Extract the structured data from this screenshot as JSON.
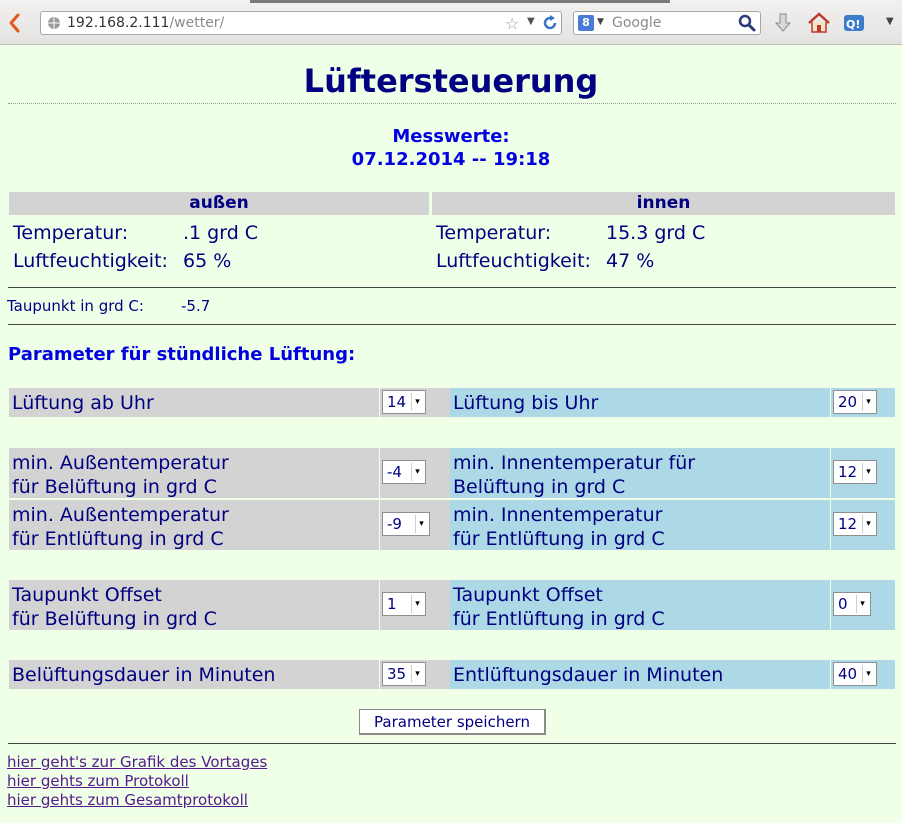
{
  "browser": {
    "url_host": "192.168.2.111",
    "url_path": "/wetter/",
    "search_placeholder": "Google"
  },
  "page": {
    "title": "Lüftersteuerung",
    "messwerte_label": "Messwerte:",
    "timestamp": "07.12.2014 -- 19:18"
  },
  "measurements": {
    "outside": {
      "header": "außen",
      "temp_label": "Temperatur:",
      "temp_value": ".1 grd C",
      "humidity_label": "Luftfeuchtigkeit:",
      "humidity_value": "65 %"
    },
    "inside": {
      "header": "innen",
      "temp_label": "Temperatur:",
      "temp_value": "15.3 grd C",
      "humidity_label": "Luftfeuchtigkeit:",
      "humidity_value": "47 %"
    },
    "dewpoint_label": "Taupunkt in grd C:",
    "dewpoint_value": "-5.7"
  },
  "params": {
    "heading": "Parameter für stündliche Lüftung:",
    "rows": [
      {
        "left_label": "Lüftung ab Uhr",
        "left_value": "14",
        "right_label": "Lüftung bis Uhr",
        "right_value": "20"
      },
      {
        "left_label1": "min. Außentemperatur",
        "left_label2": "für Belüftung in grd C",
        "left_value": "-4",
        "right_label1": "min. Innentemperatur für",
        "right_label2": "Belüftung in grd C",
        "right_value": "12"
      },
      {
        "left_label1": "min. Außentemperatur",
        "left_label2": "für Entlüftung in grd C",
        "left_value": "-9",
        "right_label1": "min. Innentemperatur",
        "right_label2": "für Entlüftung in grd C",
        "right_value": "12"
      },
      {
        "left_label1": "Taupunkt Offset",
        "left_label2": "für Belüftung in grd C",
        "left_value": "1",
        "right_label1": "Taupunkt Offset",
        "right_label2": "für Entlüftung in grd C",
        "right_value": "0"
      },
      {
        "left_label": "Belüftungsdauer in Minuten",
        "left_value": "35",
        "right_label": "Entlüftungsdauer in Minuten",
        "right_value": "40"
      }
    ],
    "save_label": "Parameter speichern"
  },
  "links": [
    "hier geht's zur Grafik des Vortages",
    "hier gehts zum Protokoll",
    "hier gehts zum Gesamtprotokoll"
  ]
}
